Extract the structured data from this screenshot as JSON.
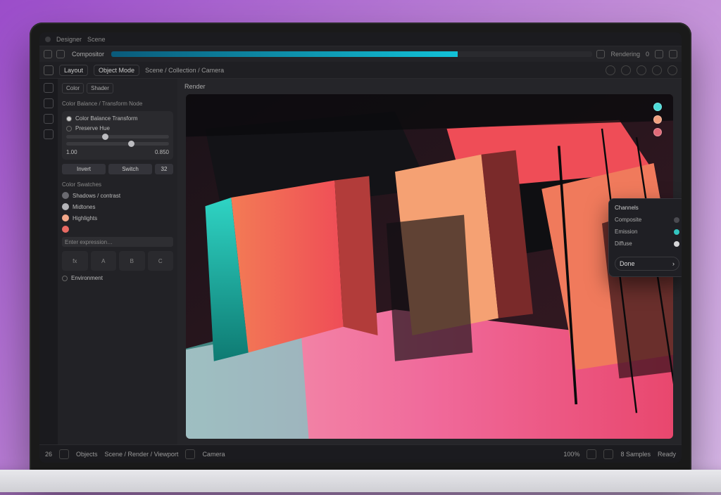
{
  "titlebar": {
    "app": "Designer",
    "doc": "Scene"
  },
  "topbar": {
    "tab": "Compositor",
    "progress_pct": 72,
    "right_label": "Rendering",
    "right_info": "0"
  },
  "secbar": {
    "chips": [
      "Layout",
      "Object Mode"
    ],
    "breadcrumb": "Scene / Collection / Camera"
  },
  "sidebar": {
    "tabs": [
      "Color",
      "Shader"
    ],
    "section1": "Color Balance / Transform Node",
    "panel1": {
      "opt1": "Color Balance Transform",
      "opt2": "Preserve Hue",
      "slider1_pct": 35,
      "slider2_pct": 60,
      "val_a": "1.00",
      "val_b": "0.850"
    },
    "btns": {
      "left": "Invert",
      "right": "Switch",
      "val": "32"
    },
    "section2": "Color Swatches",
    "swatches": [
      {
        "name": "midgray",
        "hex": "#6a6a70"
      },
      {
        "name": "neutral",
        "hex": "#b4b4b8"
      },
      {
        "name": "peach",
        "hex": "#f3a88a"
      },
      {
        "name": "coral",
        "hex": "#e86a63"
      }
    ],
    "swatch_labels": [
      "Shadows / contrast",
      "Midtones",
      "Highlights"
    ],
    "input_label": "Enter expression…",
    "bottom_cells": [
      "fx",
      "A",
      "B",
      "C"
    ],
    "bottom_row": "Environment"
  },
  "canvas": {
    "header": "Render",
    "badges": [
      {
        "name": "cyan",
        "hex": "#4ddbd8"
      },
      {
        "name": "peach",
        "hex": "#f1a07f"
      },
      {
        "name": "rose",
        "hex": "#e06a78"
      }
    ]
  },
  "floatPanel": {
    "title": "Channels",
    "rows": [
      {
        "label": "Composite",
        "hex": "#4a4a50"
      },
      {
        "label": "Emission",
        "hex": "#33c5c0"
      },
      {
        "label": "Diffuse",
        "hex": "#d6d6d8"
      }
    ],
    "button": "Done"
  },
  "status": {
    "left_num": "26",
    "left_label": "Objects",
    "path": "Scene / Render / Viewport",
    "mid": "Camera",
    "zoom": "100%",
    "right1": "8 Samples",
    "right2": "Ready"
  },
  "colors": {
    "accent": "#12c2d8",
    "coral": "#ef5b5b",
    "peach": "#f5a173",
    "teal": "#35d0c3",
    "pink": "#f06a9b"
  }
}
